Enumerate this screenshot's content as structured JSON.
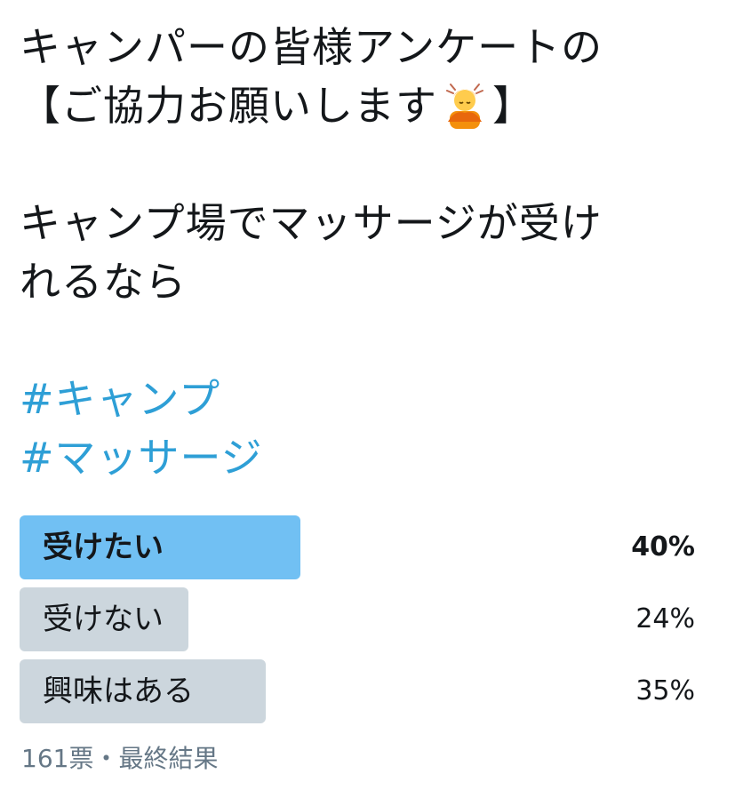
{
  "tweet": {
    "line1": "キャンパーの皆様アンケートの",
    "line2_before_emoji": "【ご協力お願いします",
    "emoji": "person-bowing-icon",
    "line2_after_emoji": "】",
    "line3": "キャンプ場でマッサージが受け",
    "line4": "れるなら",
    "hashtags": [
      "#キャンプ",
      "#マッサージ"
    ]
  },
  "poll": {
    "options": [
      {
        "label": "受けたい",
        "percent_text": "40%",
        "percent": 40,
        "winner": true
      },
      {
        "label": "受けない",
        "percent_text": "24%",
        "percent": 24,
        "winner": false
      },
      {
        "label": "興味はある",
        "percent_text": "35%",
        "percent": 35,
        "winner": false
      }
    ],
    "footer": "161票・最終結果"
  },
  "colors": {
    "hashtag": "#2e9fd6",
    "winner_bar": "#71c0f3",
    "other_bar": "#ccd6dd",
    "footer_text": "#657786"
  }
}
